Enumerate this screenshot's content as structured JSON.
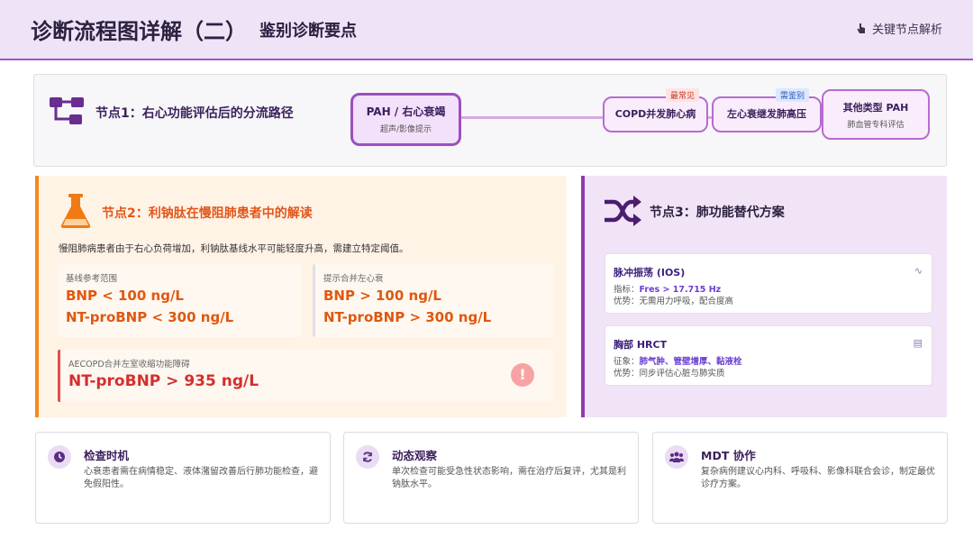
{
  "header": {
    "title": "诊断流程图详解（二）",
    "subtitle": "鉴别诊断要点",
    "link_label": "关键节点解析",
    "link_icon": "hand-pointer-icon"
  },
  "node1": {
    "icon": "sitemap-icon",
    "title": "节点1：右心功能评估后的分流路径",
    "main_pill": {
      "label": "PAH / 右心衰竭",
      "sub": "超声/影像提示"
    },
    "pills": [
      {
        "label": "COPD并发肺心病",
        "badge": "最常见"
      },
      {
        "label": "左心衰继发肺高压",
        "badge": "需鉴别"
      },
      {
        "label": "其他类型 PAH",
        "sub": "肺血管专科评估"
      }
    ],
    "colors": {
      "accent": "#9b59c9",
      "badge_red": "#ffe3e3",
      "badge_blue": "#dbe8ff"
    }
  },
  "node2": {
    "icon": "flask-icon",
    "title": "节点2：利钠肽在慢阻肺患者中的解读",
    "desc": "慢阻肺病患者由于右心负荷增加，利钠肽基线水平可能轻度升高，需建立特定阈值。",
    "box1": {
      "label": "基线参考范围",
      "v1": "BNP < 100 ng/L",
      "v2": "NT-proBNP < 300 ng/L"
    },
    "box2": {
      "label": "提示合并左心衰",
      "v1": "BNP > 100 ng/L",
      "v2": "NT-proBNP > 300 ng/L"
    },
    "alert": {
      "label": "AECOPD合并左室收缩功能障碍",
      "value": "NT-proBNP > 935 ng/L",
      "icon": "exclamation-icon"
    },
    "colors": {
      "accent": "#f5891f",
      "alert": "#d32f2f"
    }
  },
  "node3": {
    "icon": "shuffle-icon",
    "title": "节点3：肺功能替代方案",
    "cards": [
      {
        "title": "脉冲振荡 (IOS)",
        "l2_prefix": "指标：",
        "l2_value": "Fres > 17.715 Hz",
        "l3": "优势：无需用力呼吸，配合度高",
        "icon": "wave-icon"
      },
      {
        "title": "胸部 HRCT",
        "l2_prefix": "征象：",
        "l2_value": "肺气肿、管壁增厚、黏液栓",
        "l3": "优势：同步评估心脏与肺实质",
        "icon": "image-icon"
      }
    ],
    "colors": {
      "accent": "#8e3bb0"
    }
  },
  "bottom_cards": [
    {
      "icon": "clock-icon",
      "title": "检查时机",
      "desc": "心衰患者需在病情稳定、液体潴留改善后行肺功能检查，避免假阳性。"
    },
    {
      "icon": "refresh-icon",
      "title": "动态观察",
      "desc": "单次检查可能受急性状态影响，需在治疗后复评，尤其是利钠肽水平。"
    },
    {
      "icon": "users-icon",
      "title": "MDT 协作",
      "desc": "复杂病例建议心内科、呼吸科、影像科联合会诊，制定最优诊疗方案。"
    }
  ]
}
